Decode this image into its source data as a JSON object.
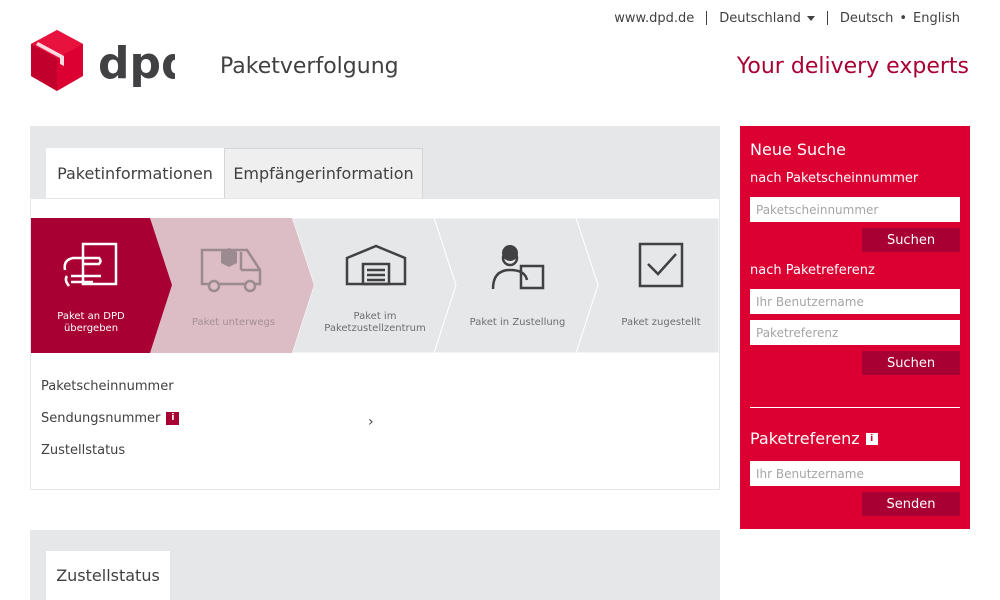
{
  "topbar": {
    "site": "www.dpd.de",
    "country": "Deutschland",
    "lang_de": "Deutsch",
    "lang_sep": "•",
    "lang_en": "English"
  },
  "header": {
    "logo_text": "dpd",
    "title": "Paketverfolgung",
    "tagline": "Your delivery experts"
  },
  "colors": {
    "brand_red": "#dc0032",
    "dark_red": "#a90034",
    "light_pink": "#dcbcc5",
    "grey": "#e6e7e8"
  },
  "tabs": {
    "paketinfo": "Paketinformationen",
    "empfaenger": "Empfängerinformation"
  },
  "steps": [
    {
      "label1": "Paket an DPD",
      "label2": "übergeben",
      "icon": "hand-package-icon"
    },
    {
      "label1": "Paket unterwegs",
      "label2": "",
      "icon": "truck-icon"
    },
    {
      "label1": "Paket im",
      "label2": "Paketzustellzentrum",
      "icon": "depot-icon"
    },
    {
      "label1": "Paket in Zustellung",
      "label2": "",
      "icon": "courier-icon"
    },
    {
      "label1": "Paket zugestellt",
      "label2": "",
      "icon": "checkbox-icon"
    }
  ],
  "details": {
    "paketscheinnummer": "Paketscheinnummer",
    "sendungsnummer": "Sendungsnummer",
    "zustellstatus": "Zustellstatus",
    "info": "i",
    "chevron": "›"
  },
  "status_card": {
    "tab": "Zustellstatus"
  },
  "search": {
    "title": "Neue Suche",
    "by_number_label": "nach Paketscheinnummer",
    "number_placeholder": "Paketscheinnummer",
    "search_btn_1": "Suchen",
    "by_ref_label": "nach Paketreferenz",
    "user_placeholder_1": "Ihr Benutzername",
    "ref_placeholder": "Paketreferenz",
    "search_btn_2": "Suchen",
    "ref_section_title": "Paketreferenz",
    "info": "i",
    "user_placeholder_2": "Ihr Benutzername",
    "send_btn": "Senden"
  }
}
